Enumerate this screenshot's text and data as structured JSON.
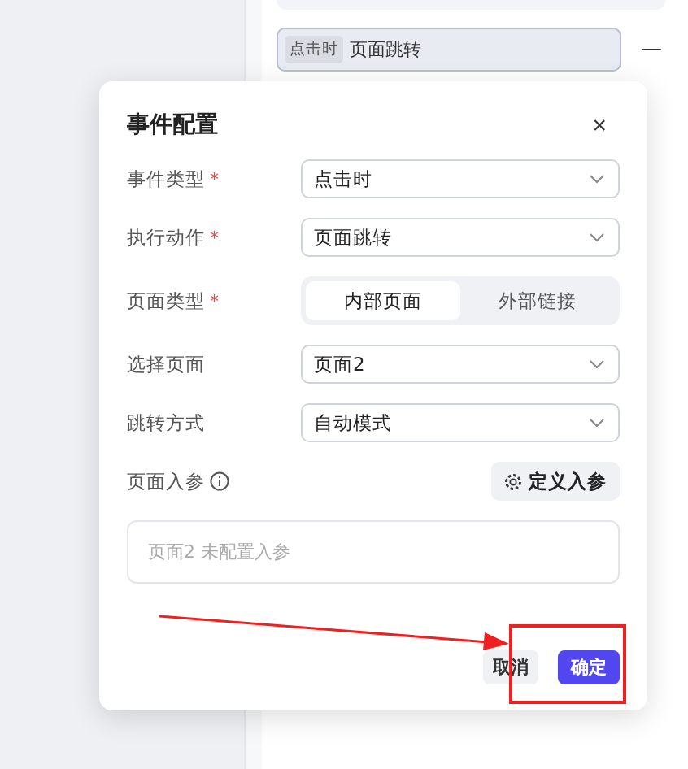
{
  "event_item": {
    "tag": "点击时",
    "label": "页面跳转",
    "remove": "—"
  },
  "dialog": {
    "title": "事件配置",
    "close": "×",
    "required_mark": "*",
    "fields": [
      {
        "kind": "select",
        "label": "事件类型",
        "required": true,
        "value": "点击时"
      },
      {
        "kind": "select",
        "label": "执行动作",
        "required": true,
        "value": "页面跳转"
      },
      {
        "kind": "segmented",
        "label": "页面类型",
        "required": true,
        "options": [
          {
            "label": "内部页面",
            "selected": true
          },
          {
            "label": "外部链接",
            "selected": false
          }
        ]
      },
      {
        "kind": "select",
        "label": "选择页面",
        "required": false,
        "value": "页面2"
      },
      {
        "kind": "select",
        "label": "跳转方式",
        "required": false,
        "value": "自动模式"
      }
    ],
    "params": {
      "label": "页面入参",
      "button": "定义入参",
      "empty": "页面2 未配置入参"
    },
    "buttons": [
      {
        "label": "取消",
        "primary": false
      },
      {
        "label": "确定",
        "primary": true
      }
    ]
  }
}
